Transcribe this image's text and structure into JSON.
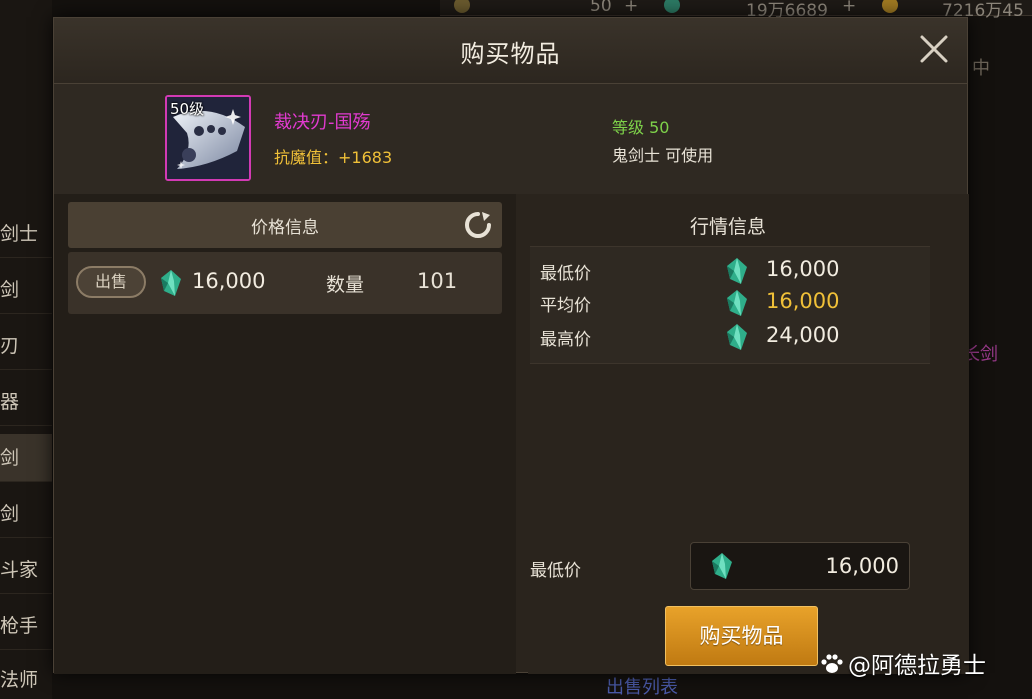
{
  "background": {
    "topbar": {
      "values": [
        "50",
        "19万6689",
        "7216万45"
      ]
    },
    "sidebar": {
      "items": [
        "剑士",
        "剑",
        "刃",
        "器",
        "剑",
        "剑",
        "斗家",
        "枪手",
        "法师"
      ]
    },
    "right_partial": [
      "中",
      "长剑"
    ],
    "bottom_link": "出售列表"
  },
  "modal": {
    "title": "购买物品",
    "close_icon": "close-icon",
    "item": {
      "level_badge": "50级",
      "name": "裁决刃-国殇",
      "stat": "抗魔值：+1683",
      "required_level": "等级 50",
      "usable_by": "鬼剑士 可使用",
      "rarity_color": "#d23ab4"
    },
    "price_info": {
      "title": "价格信息",
      "refresh_icon": "refresh-icon",
      "listing": {
        "badge": "出售",
        "price": "16,000",
        "qty_label": "数量",
        "qty_value": "101"
      }
    },
    "market_info": {
      "title": "行情信息",
      "rows": [
        {
          "label": "最低价",
          "value": "16,000",
          "color": "#f2ece0"
        },
        {
          "label": "平均价",
          "value": "16,000",
          "color": "#f0c038"
        },
        {
          "label": "最高价",
          "value": "24,000",
          "color": "#f2ece0"
        }
      ]
    },
    "purchase": {
      "min_price_label": "最低价",
      "price_value": "16,000",
      "buy_button": "购买物品"
    },
    "currency_icon": "gem-icon"
  },
  "watermark": "@阿德拉勇士",
  "colors": {
    "accent_gold": "#e8a22a",
    "rare_purple": "#d23ab4",
    "level_green": "#7ed24a",
    "stat_yellow": "#f0c038"
  }
}
